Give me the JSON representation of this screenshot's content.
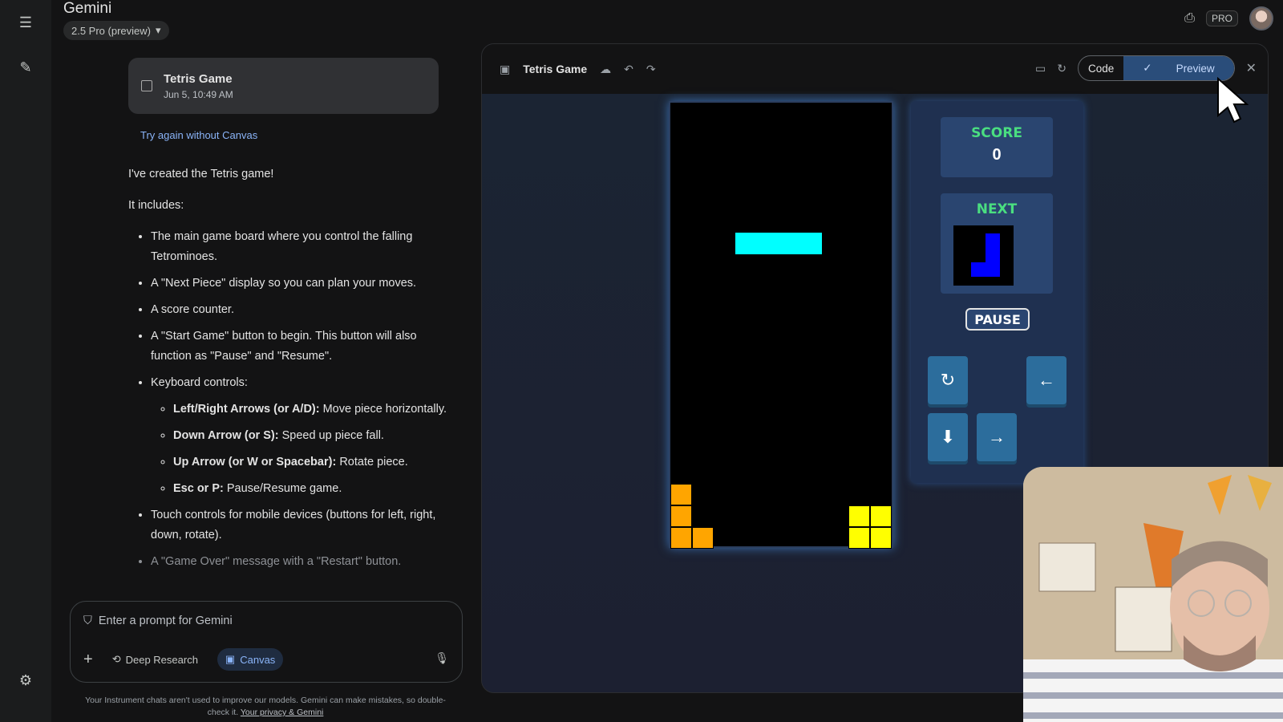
{
  "app": {
    "title": "Gemini",
    "model_chip": "2.5 Pro (preview)",
    "pro_badge": "PRO"
  },
  "chat": {
    "canvas_card": {
      "title": "Tetris Game",
      "date": "Jun 5, 10:49 AM"
    },
    "try_again": "Try again without Canvas",
    "intro": "I've created the Tetris game!",
    "includes_label": "It includes:",
    "bullets": [
      "The main game board where you control the falling Tetrominoes.",
      "A \"Next Piece\" display so you can plan your moves.",
      "A score counter.",
      "A \"Start Game\" button to begin. This button will also function as \"Pause\" and \"Resume\".",
      "Keyboard controls:"
    ],
    "controls": [
      {
        "key": "Left/Right Arrows (or A/D):",
        "desc": " Move piece horizontally."
      },
      {
        "key": "Down Arrow (or S):",
        "desc": " Speed up piece fall."
      },
      {
        "key": "Up Arrow (or W or Spacebar):",
        "desc": " Rotate piece."
      },
      {
        "key": "Esc or P:",
        "desc": " Pause/Resume game."
      }
    ],
    "touch_bullet": "Touch controls for mobile devices (buttons for left, right, down, rotate).",
    "gameover_bullet": "A \"Game Over\" message with a \"Restart\" button."
  },
  "composer": {
    "placeholder": "Enter a prompt for Gemini",
    "deep_research": "Deep Research",
    "canvas": "Canvas"
  },
  "disclaimer": {
    "text": "Your Instrument chats aren't used to improve our models. Gemini can make mistakes, so double-check it.",
    "link": "Your privacy & Gemini"
  },
  "panel": {
    "title": "Tetris Game",
    "code_label": "Code",
    "preview_label": "Preview"
  },
  "game": {
    "score_label": "SCORE",
    "score_value": "0",
    "next_label": "NEXT",
    "pause_label": "PAUSE",
    "colors": {
      "i_piece": "#00ffff",
      "l_piece": "#ffa500",
      "o_piece": "#ffff00",
      "j_piece": "#0000ff"
    }
  }
}
